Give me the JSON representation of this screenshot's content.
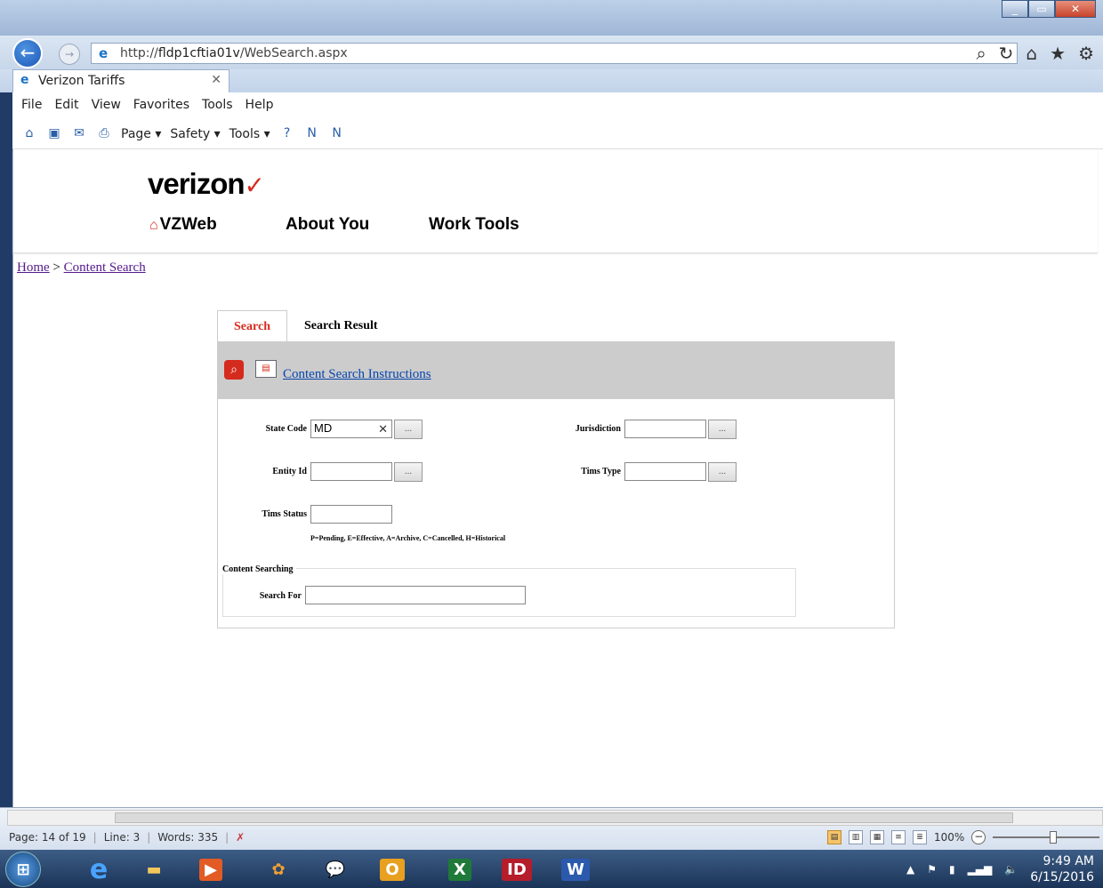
{
  "browser": {
    "url_prefix": "http://",
    "url_host": "fldp1cftia01v",
    "url_path": "/WebSearch.aspx",
    "tab_title": "Verizon Tariffs",
    "menu": [
      "File",
      "Edit",
      "View",
      "Favorites",
      "Tools",
      "Help"
    ],
    "commands": {
      "page": "Page ▾",
      "safety": "Safety ▾",
      "tools": "Tools ▾"
    }
  },
  "site": {
    "logo": "verizon",
    "nav": {
      "home": "VZWeb",
      "about": "About You",
      "tools": "Work Tools"
    }
  },
  "breadcrumb": {
    "home": "Home",
    "sep": " > ",
    "current": "Content Search"
  },
  "tabs": {
    "search": "Search",
    "result": "Search Result"
  },
  "panel": {
    "instructions_link": "Content Search Instructions"
  },
  "form": {
    "state_code": {
      "label": "State Code",
      "value": "MD"
    },
    "jurisdiction": {
      "label": "Jurisdiction",
      "value": ""
    },
    "entity_id": {
      "label": "Entity Id",
      "value": ""
    },
    "tims_type": {
      "label": "Tims Type",
      "value": ""
    },
    "tims_status": {
      "label": "Tims Status",
      "value": ""
    },
    "status_legend": "P=Pending, E=Effective, A=Archive, C=Cancelled, H=Historical",
    "browse_label": "...",
    "content_searching": "Content Searching",
    "search_for": {
      "label": "Search For",
      "value": ""
    }
  },
  "word_status": {
    "page": "Page: 14 of 19",
    "line": "Line: 3",
    "words": "Words: 335",
    "zoom": "100%"
  },
  "taskbar": {
    "time": "9:49 AM",
    "date": "6/15/2016"
  },
  "colors": {
    "accent": "#d52b1e",
    "link": "#0645ad",
    "visited": "#551a8b",
    "panel_head": "#cccccc"
  }
}
